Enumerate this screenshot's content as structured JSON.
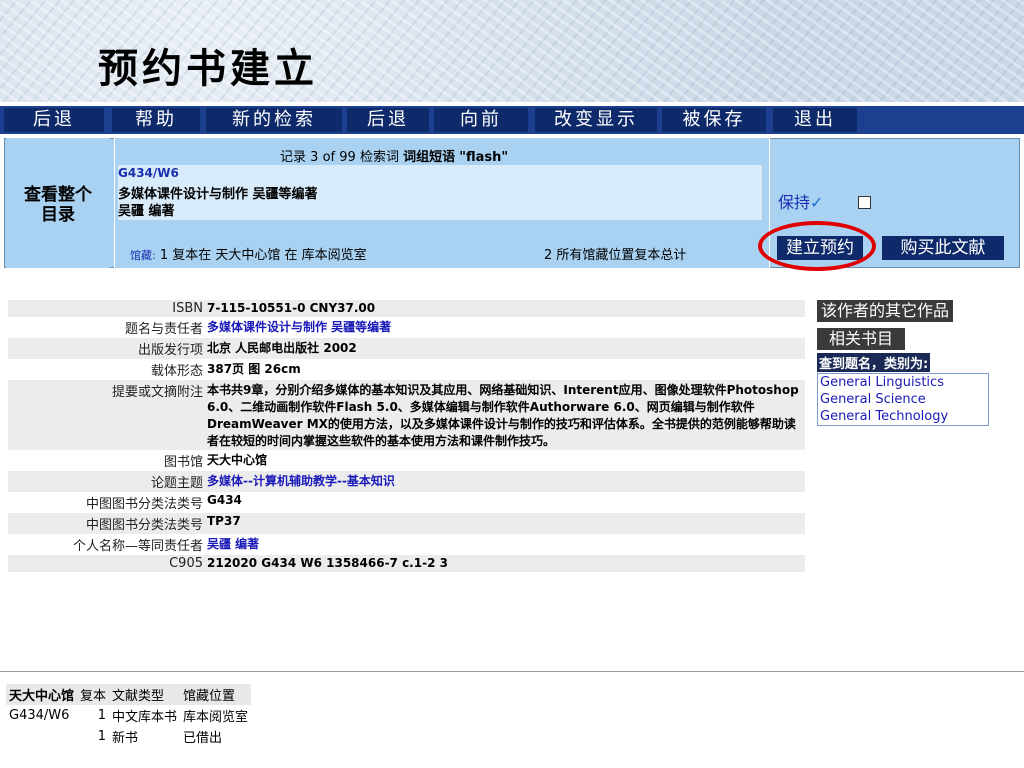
{
  "banner": {
    "title": "预约书建立"
  },
  "nav": {
    "items": [
      "后退",
      "帮助",
      "新的检索",
      "后退",
      "向前",
      "改变显示",
      "被保存",
      "退出"
    ]
  },
  "record": {
    "view_full_line1": "查看整个",
    "view_full_line2": "目录",
    "header": {
      "prefix": "记录",
      "index": "3",
      "of": "of",
      "total": "99",
      "search_word_label": "检索词",
      "phrase_label": "词组短语",
      "query": "\"flash\""
    },
    "call_number": "G434/W6",
    "title_line": "多媒体课件设计与制作 吴疆等编著",
    "author_line": "吴疆 编著",
    "holdings_label": "馆藏:",
    "holdings_text": "1 复本在 天大中心馆 在 库本阅览室",
    "holdings_total": "2 所有馆藏位置复本总计",
    "keep_label": "保持",
    "reserve_button": "建立预约",
    "buy_button": "购买此文献"
  },
  "details": [
    {
      "label": "ISBN",
      "value": "7-115-10551-0 CNY37.00",
      "link": false
    },
    {
      "label": "题名与责任者",
      "value": "多媒体课件设计与制作 吴疆等编著",
      "link": true
    },
    {
      "label": "出版发行项",
      "value": "北京 人民邮电出版社 2002",
      "link": false
    },
    {
      "label": "载体形态",
      "value": "387页 图 26cm",
      "link": false
    },
    {
      "label": "提要或文摘附注",
      "value": "本书共9章，分别介绍多媒体的基本知识及其应用、网络基础知识、Interent应用、图像处理软件Photoshop 6.0、二维动画制作软件Flash 5.0、多媒体编辑与制作软件Authorware 6.0、网页编辑与制作软件DreamWeaver MX的使用方法，以及多媒体课件设计与制作的技巧和评估体系。全书提供的范例能够帮助读者在较短的时间内掌握这些软件的基本使用方法和课件制作技巧。",
      "link": false
    },
    {
      "label": "图书馆",
      "value": "天大中心馆",
      "link": false
    },
    {
      "label": "论题主题",
      "value": "多媒体--计算机辅助教学--基本知识",
      "link": true
    },
    {
      "label": "中图图书分类法类号",
      "value": "G434",
      "link": false
    },
    {
      "label": "中图图书分类法类号",
      "value": "TP37",
      "link": false
    },
    {
      "label": "个人名称—等同责任者",
      "value": "吴疆 编著",
      "link": true
    },
    {
      "label": "C905",
      "value": "212020 G434 W6 1358466-7 c.1-2 3",
      "link": false
    }
  ],
  "sidebar": {
    "other_works": "该作者的其它作品",
    "related": "相关书目",
    "found_label": "查到题名，类别为:",
    "categories": [
      "General Linguistics",
      "General Science",
      "General Technology"
    ]
  },
  "holdings": {
    "headers": [
      "天大中心馆",
      "复本",
      "文献类型",
      "馆藏位置"
    ],
    "rows": [
      [
        "G434/W6",
        "1",
        "中文库本书",
        "库本阅览室"
      ],
      [
        "",
        "1",
        "新书",
        "已借出"
      ]
    ]
  },
  "colors": {
    "nav_button": "#0e2a6b",
    "record_panel": "#a9d2f2",
    "link_blue": "#1a1ab8",
    "highlight_ring": "#e00000"
  }
}
